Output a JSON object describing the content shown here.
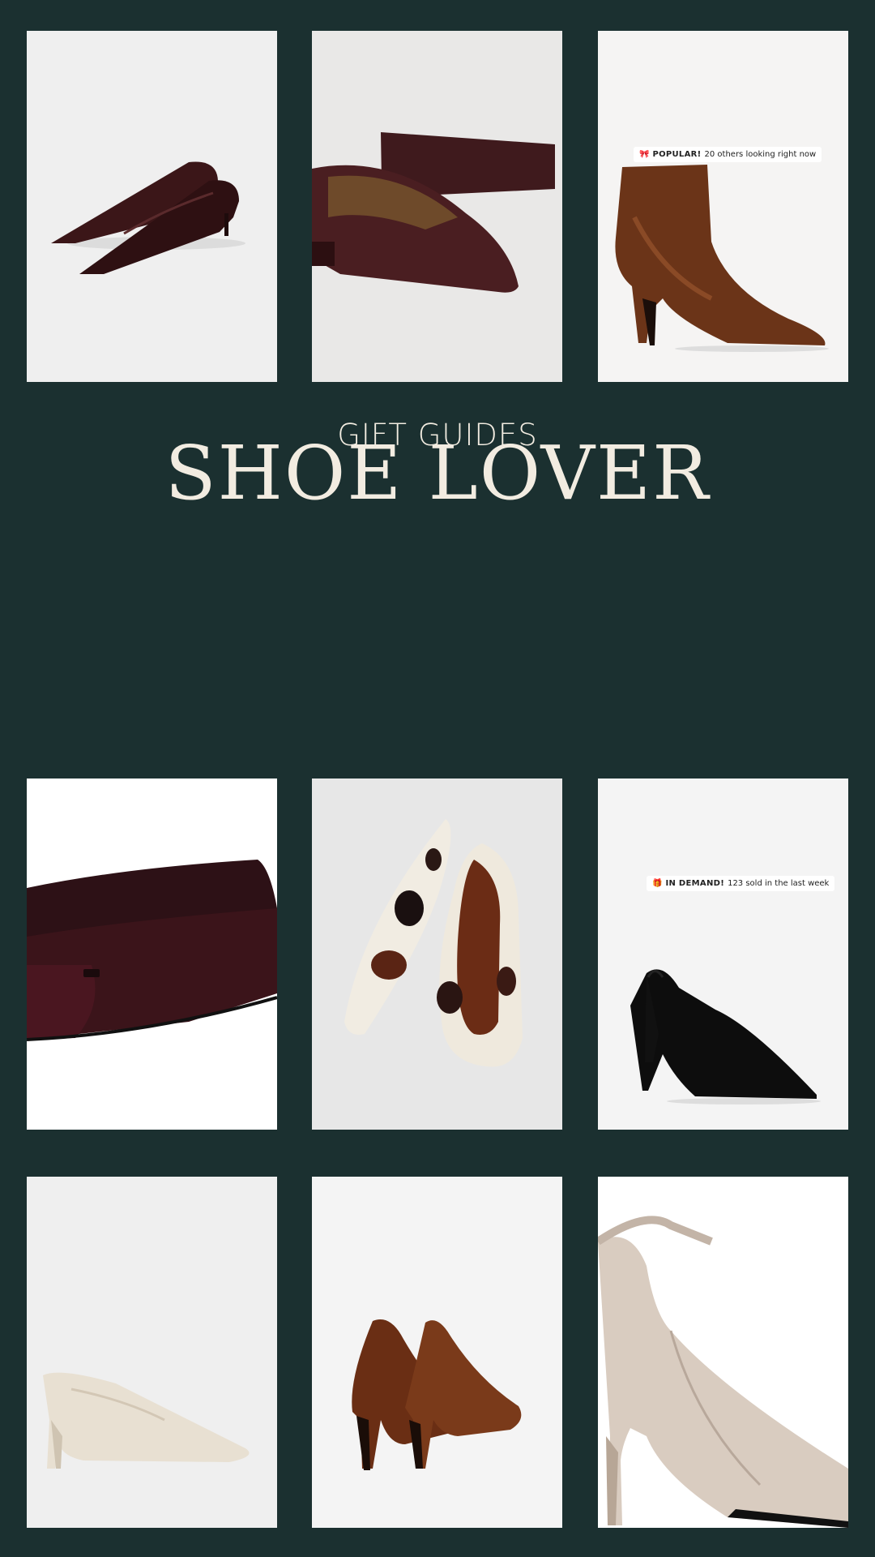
{
  "page": {
    "background": "#1b3030",
    "accent_text": "#f2ece1"
  },
  "header": {
    "kicker": "GIFT GUIDES",
    "title": "SHOE LOVER"
  },
  "products": [
    {
      "name": "burgundy-kitten-heel-pumps",
      "bg": "#efefef"
    },
    {
      "name": "burgundy-slingback-flats",
      "bg": "#e9e8e7"
    },
    {
      "name": "brown-leather-ankle-boot",
      "bg": "#f5f4f3",
      "badge": {
        "icon": "bow-icon",
        "strong": "POPULAR!",
        "text": "20 others looking right now"
      }
    },
    {
      "name": "burgundy-buckle-flats",
      "bg": "#ffffff"
    },
    {
      "name": "cow-print-ballet-flats",
      "bg": "#e7e7e7"
    },
    {
      "name": "black-cone-heel-slingback",
      "bg": "#f4f4f4",
      "badge": {
        "icon": "gift-icon",
        "strong": "IN DEMAND!",
        "text": "123 sold in the last week"
      }
    },
    {
      "name": "cream-kitten-heel-pump",
      "bg": "#efefef"
    },
    {
      "name": "brown-stiletto-pumps",
      "bg": "#f4f4f4"
    },
    {
      "name": "taupe-slingback-pump",
      "bg": "#ffffff"
    }
  ]
}
